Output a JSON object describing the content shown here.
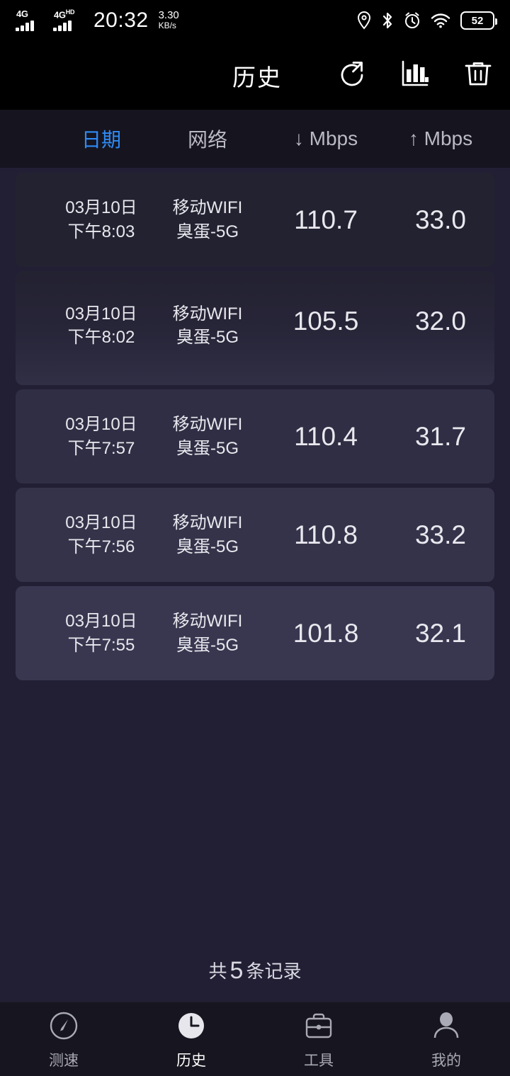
{
  "statusbar": {
    "network_type_1": "4G",
    "network_type_2": "4G",
    "network_type_2_sup": "HD",
    "time": "20:32",
    "netspeed_value": "3.30",
    "netspeed_unit": "KB/s",
    "icons": [
      "location-icon",
      "bluetooth-icon",
      "alarm-icon",
      "wifi-icon"
    ],
    "battery_percent": "52"
  },
  "appbar": {
    "title": "历史",
    "actions": [
      {
        "name": "share-icon",
        "label": "分享"
      },
      {
        "name": "bar-chart-icon",
        "label": "统计"
      },
      {
        "name": "trash-icon",
        "label": "删除"
      }
    ]
  },
  "columns": {
    "date": "日期",
    "network": "网络",
    "download": "↓ Mbps",
    "upload": "↑ Mbps",
    "active": "date",
    "active_color": "#2e8bf5"
  },
  "rows": [
    {
      "date": "03月10日",
      "time": "下午8:03",
      "net_type": "移动WIFI",
      "ssid": "臭蛋-5G",
      "download": "110.7",
      "upload": "33.0"
    },
    {
      "date": "03月10日",
      "time": "下午8:02",
      "net_type": "移动WIFI",
      "ssid": "臭蛋-5G",
      "download": "105.5",
      "upload": "32.0"
    },
    {
      "date": "03月10日",
      "time": "下午7:57",
      "net_type": "移动WIFI",
      "ssid": "臭蛋-5G",
      "download": "110.4",
      "upload": "31.7"
    },
    {
      "date": "03月10日",
      "time": "下午7:56",
      "net_type": "移动WIFI",
      "ssid": "臭蛋-5G",
      "download": "110.8",
      "upload": "33.2"
    },
    {
      "date": "03月10日",
      "time": "下午7:55",
      "net_type": "移动WIFI",
      "ssid": "臭蛋-5G",
      "download": "101.8",
      "upload": "32.1"
    }
  ],
  "footer": {
    "prefix": "共",
    "count": "5",
    "suffix": "条记录"
  },
  "tabbar": {
    "items": [
      {
        "label": "测速",
        "icon": "speedometer-icon",
        "active": false
      },
      {
        "label": "历史",
        "icon": "clock-icon",
        "active": true
      },
      {
        "label": "工具",
        "icon": "toolbox-icon",
        "active": false
      },
      {
        "label": "我的",
        "icon": "person-icon",
        "active": false
      }
    ]
  },
  "theme": {
    "background": "#221f35",
    "appbar_background": "#000000",
    "accent": "#2e8bf5",
    "text": "#e8e8ee"
  }
}
